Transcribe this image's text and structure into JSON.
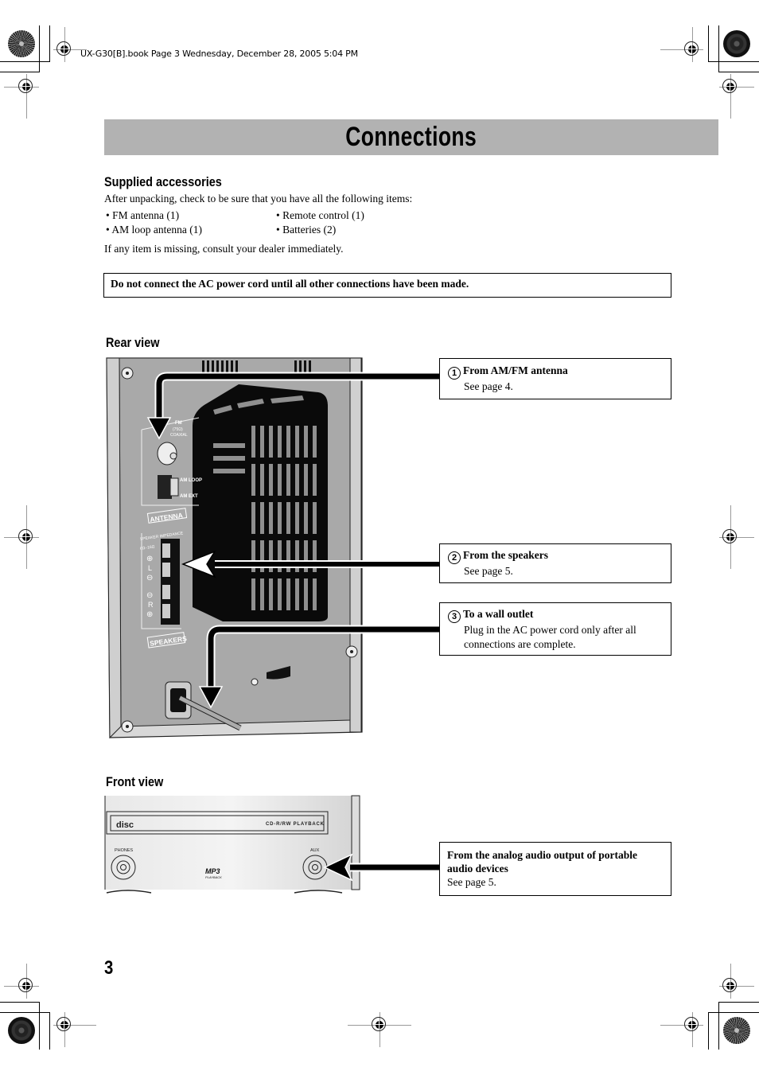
{
  "header": {
    "file_info": "UX-G30[B].book  Page 3  Wednesday, December 28, 2005  5:04 PM"
  },
  "title": "Connections",
  "supplied_accessories": {
    "heading": "Supplied accessories",
    "intro": "After unpacking, check to be sure that you have all the following items:",
    "items": [
      "• FM antenna (1)",
      "• Remote control (1)",
      "• AM loop antenna (1)",
      "• Batteries (2)"
    ],
    "footer": "If any item is missing, consult your dealer immediately."
  },
  "warning": "Do not connect the AC power cord until all other connections have been made.",
  "rear_view": {
    "heading": "Rear view",
    "panel_labels": {
      "fm": "FM",
      "fm_ohm": "(75Ω)",
      "fm_coaxial": "COAXIAL",
      "am_loop": "AM LOOP",
      "am_ext": "AM EXT",
      "antenna": "ANTENNA",
      "speaker_impedance": "SPEAKER IMPEDANCE",
      "impedance_range": "6Ω–16Ω",
      "left": "L",
      "right": "R",
      "speakers": "SPEAKERS"
    },
    "callouts": [
      {
        "number": "1",
        "title": "From AM/FM antenna",
        "text": "See page 4."
      },
      {
        "number": "2",
        "title": "From the speakers",
        "text": "See page 5."
      },
      {
        "number": "3",
        "title": "To a wall outlet",
        "text": "Plug in the AC power cord only after all connections are complete."
      }
    ]
  },
  "front_view": {
    "heading": "Front view",
    "panel_labels": {
      "disc_logo": "disc",
      "cd_playback": "CD-R/RW PLAYBACK",
      "phones": "PHONES",
      "aux": "AUX",
      "mp3": "MP3",
      "mp3_sub": "PLAYBACK"
    },
    "callout": {
      "title": "From the analog audio output of portable audio devices",
      "text": "See page 5."
    }
  },
  "page_number": "3"
}
